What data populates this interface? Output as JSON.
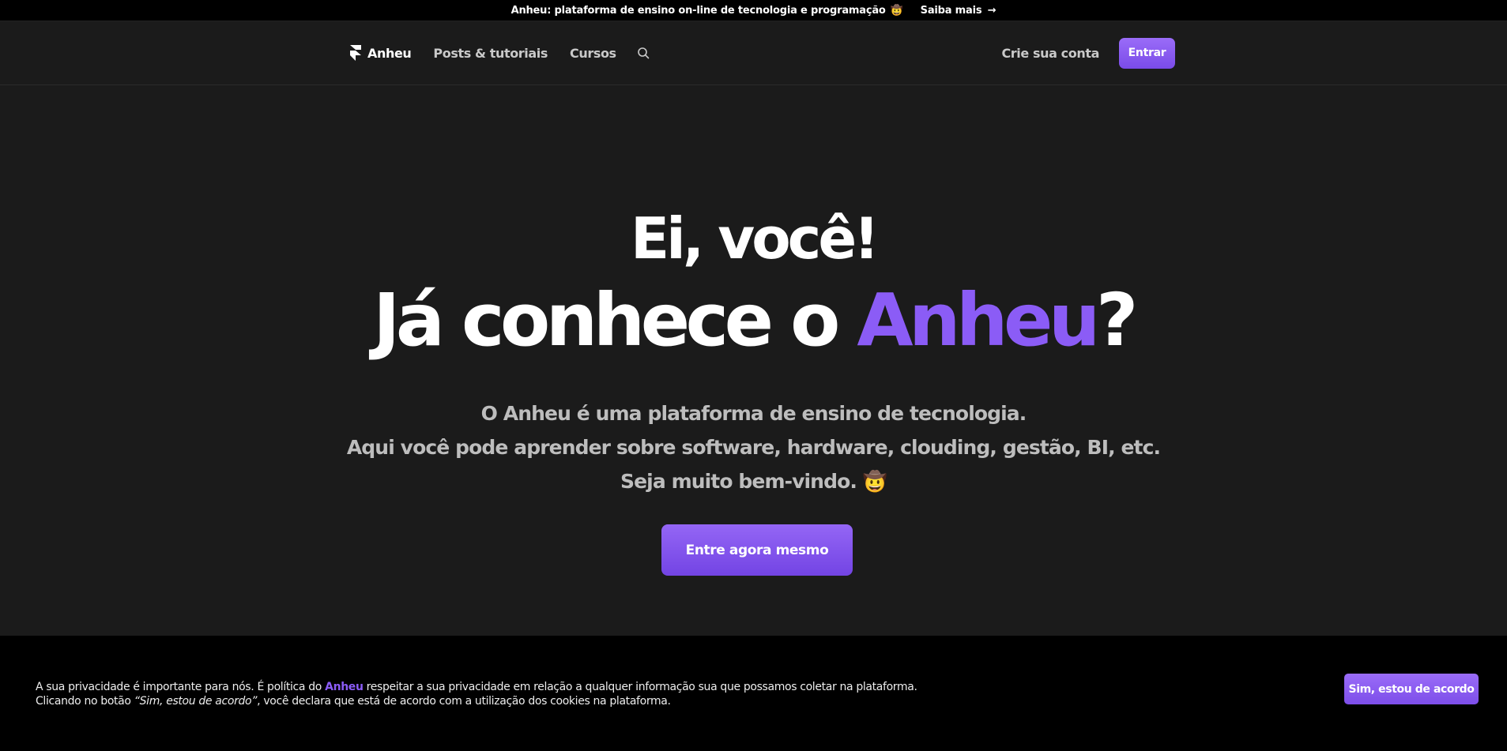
{
  "announcement": {
    "text": "Anheu: plataforma de ensino on-line de tecnologia e programação",
    "emoji": "🤠",
    "link_label": "Saiba mais",
    "link_arrow": "→"
  },
  "navbar": {
    "brand": "Anheu",
    "brand_icon": "anheu-logo-icon",
    "links": [
      "Posts & tutoriais",
      "Cursos"
    ],
    "search_icon": "search-icon",
    "signup_label": "Crie sua conta",
    "login_label": "Entrar"
  },
  "hero": {
    "greeting": "Ei, você!",
    "title_prefix": "Já conhece o ",
    "title_accent": "Anheu",
    "title_suffix": "?",
    "description_lines": [
      "O Anheu é uma plataforma de ensino de tecnologia.",
      "Aqui você pode aprender sobre software, hardware, clouding, gestão, BI, etc.",
      "Seja muito bem-vindo."
    ],
    "welcome_emoji": "🤠",
    "cta_label": "Entre agora mesmo"
  },
  "cookie_banner": {
    "line1_prefix": "A sua privacidade é importante para nós. É política do ",
    "line1_brand": "Anheu",
    "line1_suffix": " respeitar a sua privacidade em relação a qualquer informação sua que possamos coletar na plataforma.",
    "line2_prefix": "Clicando no botão ",
    "line2_quote": "“Sim, estou de acordo”",
    "line2_suffix": ", você declara que está de acordo com a utilização dos cookies na plataforma.",
    "accept_label": "Sim, estou de acordo"
  },
  "colors": {
    "accent": "#8b5cf6",
    "background": "#1b1b1b",
    "bar": "#000000"
  }
}
